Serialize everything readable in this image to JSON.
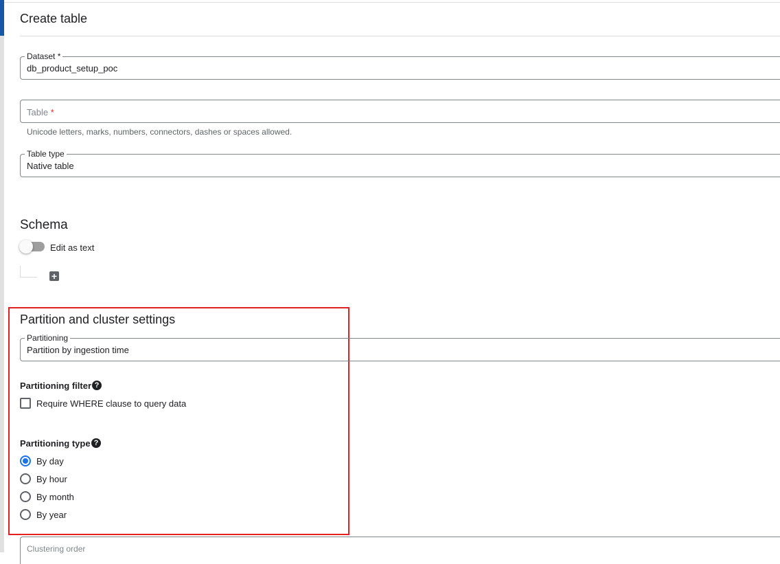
{
  "header": {
    "title": "Create table"
  },
  "dataset": {
    "label": "Dataset",
    "required_mark": "*",
    "value": "db_product_setup_poc"
  },
  "table": {
    "placeholder": "Table",
    "required_mark": "*",
    "hint": "Unicode letters, marks, numbers, connectors, dashes or spaces allowed."
  },
  "table_type": {
    "label": "Table type",
    "value": "Native table"
  },
  "schema": {
    "title": "Schema",
    "edit_as_text_label": "Edit as text",
    "edit_as_text_on": false,
    "add_icon": "plus-box-icon"
  },
  "partition": {
    "title": "Partition and cluster settings",
    "partitioning": {
      "label": "Partitioning",
      "value": "Partition by ingestion time"
    },
    "filter": {
      "title": "Partitioning filter",
      "help_icon": "help-circle-icon",
      "checkbox_label": "Require WHERE clause to query data",
      "checked": false
    },
    "type": {
      "title": "Partitioning type",
      "help_icon": "help-circle-icon",
      "options": [
        {
          "label": "By day",
          "selected": true
        },
        {
          "label": "By hour",
          "selected": false
        },
        {
          "label": "By month",
          "selected": false
        },
        {
          "label": "By year",
          "selected": false
        }
      ]
    }
  },
  "clustering": {
    "placeholder": "Clustering order"
  },
  "colors": {
    "accent": "#1a56a7",
    "radio_selected": "#1a73e8",
    "highlight_border": "#e32020",
    "required": "#d93025"
  }
}
